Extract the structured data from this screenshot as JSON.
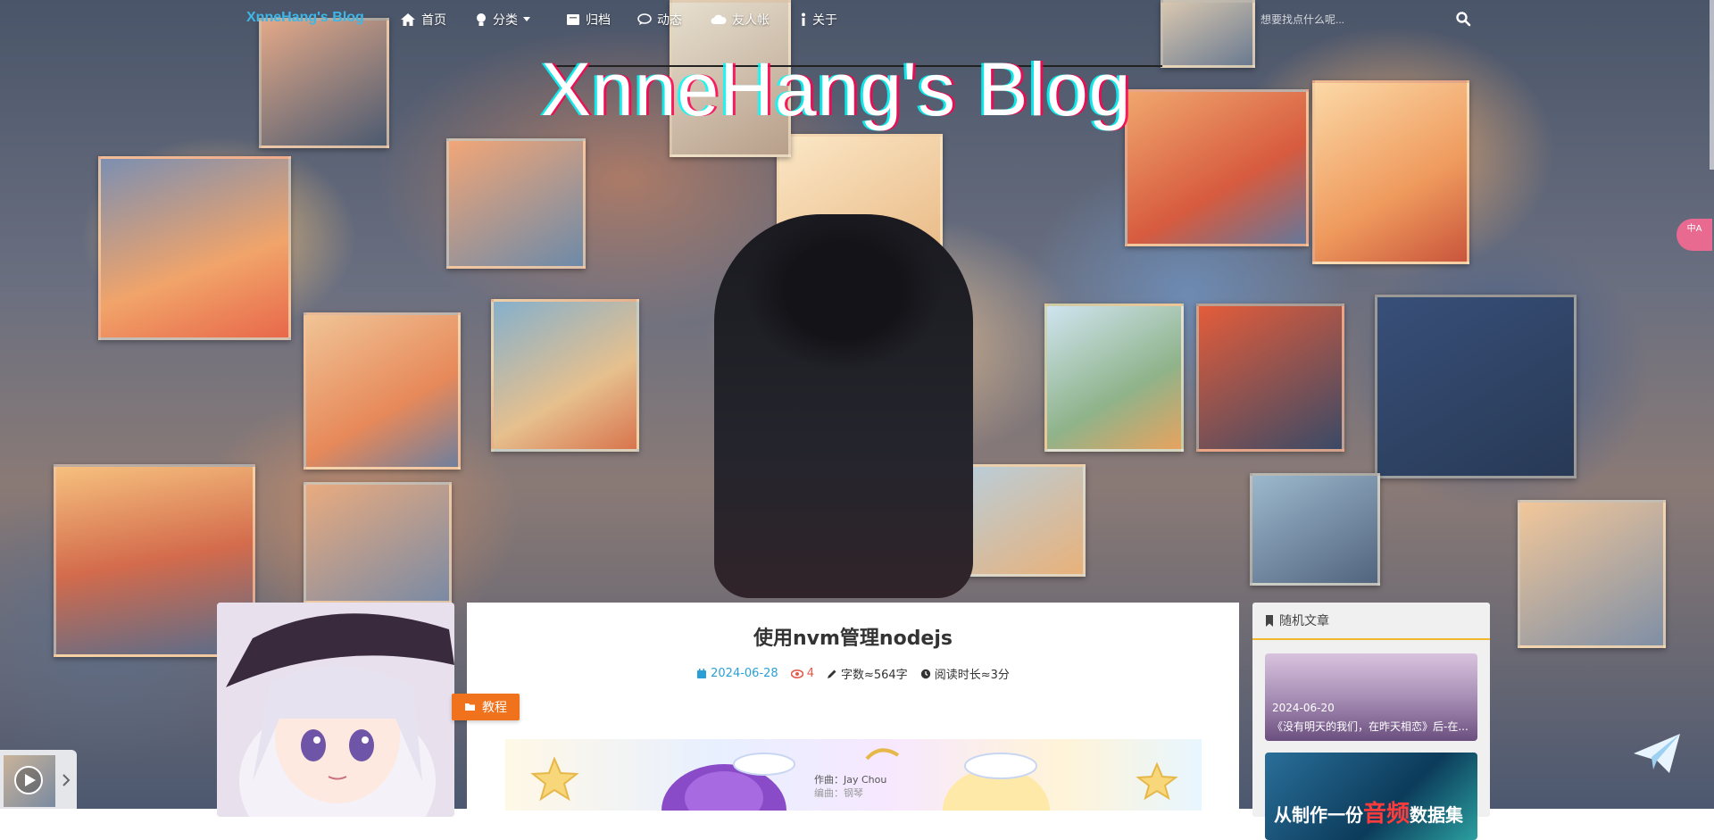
{
  "nav": {
    "brand": "XnneHang's Blog",
    "items": [
      {
        "label": "首页",
        "icon": "home-icon"
      },
      {
        "label": "分类",
        "icon": "lightbulb-icon",
        "dropdown": true
      },
      {
        "label": "归档",
        "icon": "archive-icon"
      },
      {
        "label": "动态",
        "icon": "chat-icon"
      },
      {
        "label": "友人帐",
        "icon": "cloud-icon"
      },
      {
        "label": "关于",
        "icon": "info-icon"
      }
    ],
    "search_placeholder": "想要找点什么呢..."
  },
  "hero": {
    "title": "XnneHang's Blog"
  },
  "lang_toggle": {
    "text": "中A"
  },
  "article": {
    "title": "使用nvm管理nodejs",
    "date": "2024-06-28",
    "views": "4",
    "words": "字数≈564字",
    "read_time": "阅读时长≈3分",
    "tag": "教程",
    "cover_music_credit": "作曲：Jay Chou",
    "cover_music_line2": "编曲：钢琴"
  },
  "sidebar": {
    "title": "随机文章",
    "posts": [
      {
        "date": "2024-06-20",
        "title": "《没有明天的我们，在昨天相恋》后-在..."
      },
      {
        "title_prefix": "从制作一份",
        "title_highlight": "音频",
        "title_suffix": "数据集"
      }
    ]
  },
  "colors": {
    "brand": "#3cb7e8",
    "accent": "#f0721d",
    "date": "#2a9fd6",
    "views": "#e35a4c",
    "sidebar_rule": "#f0b82a"
  }
}
